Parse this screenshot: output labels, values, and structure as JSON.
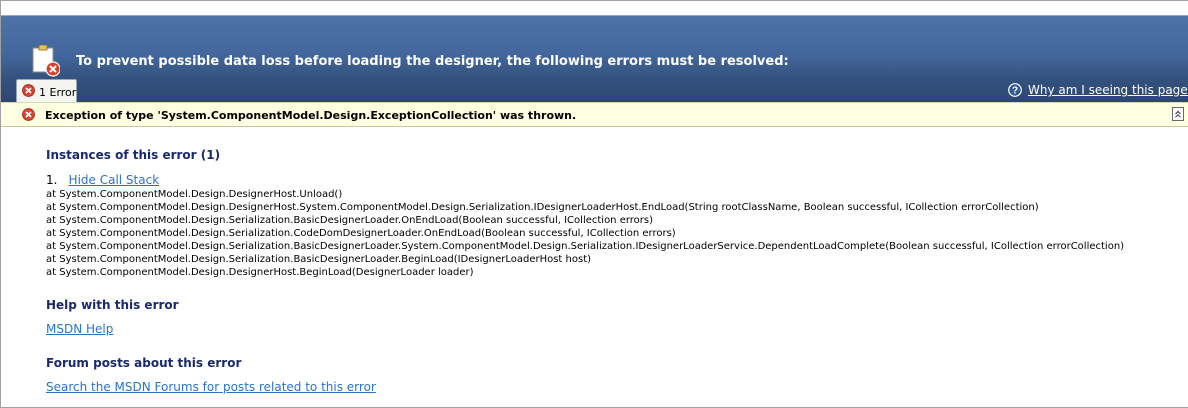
{
  "banner": {
    "title": "To prevent possible data loss before loading the designer, the following errors must be resolved:",
    "tab_label": "1 Error",
    "help_link": "Why am I seeing this page?"
  },
  "error": {
    "message": "Exception of type 'System.ComponentModel.Design.ExceptionCollection' was thrown."
  },
  "instances": {
    "heading": "Instances of this error (1)",
    "item_number": "1.",
    "toggle_link": "Hide Call Stack",
    "stack": [
      "at System.ComponentModel.Design.DesignerHost.Unload()",
      "at System.ComponentModel.Design.DesignerHost.System.ComponentModel.Design.Serialization.IDesignerLoaderHost.EndLoad(String rootClassName, Boolean successful, ICollection errorCollection)",
      "at System.ComponentModel.Design.Serialization.BasicDesignerLoader.OnEndLoad(Boolean successful, ICollection errors)",
      "at System.ComponentModel.Design.Serialization.CodeDomDesignerLoader.OnEndLoad(Boolean successful, ICollection errors)",
      "at System.ComponentModel.Design.Serialization.BasicDesignerLoader.System.ComponentModel.Design.Serialization.IDesignerLoaderService.DependentLoadComplete(Boolean successful, ICollection errorCollection)",
      "at System.ComponentModel.Design.Serialization.BasicDesignerLoader.BeginLoad(IDesignerLoaderHost host)",
      "at System.ComponentModel.Design.DesignerHost.BeginLoad(DesignerLoader loader)"
    ]
  },
  "help": {
    "heading": "Help with this error",
    "link": "MSDN Help"
  },
  "forum": {
    "heading": "Forum posts about this error",
    "link": "Search the MSDN Forums for posts related to this error"
  },
  "colors": {
    "banner": "#43679c",
    "error_bar": "#ffffe1",
    "heading": "#1a2a6c",
    "link": "#2a74c8",
    "error_icon": "#d8412b"
  },
  "icons": [
    "document-error-icon",
    "error-icon",
    "help-icon",
    "collapse-icon"
  ]
}
